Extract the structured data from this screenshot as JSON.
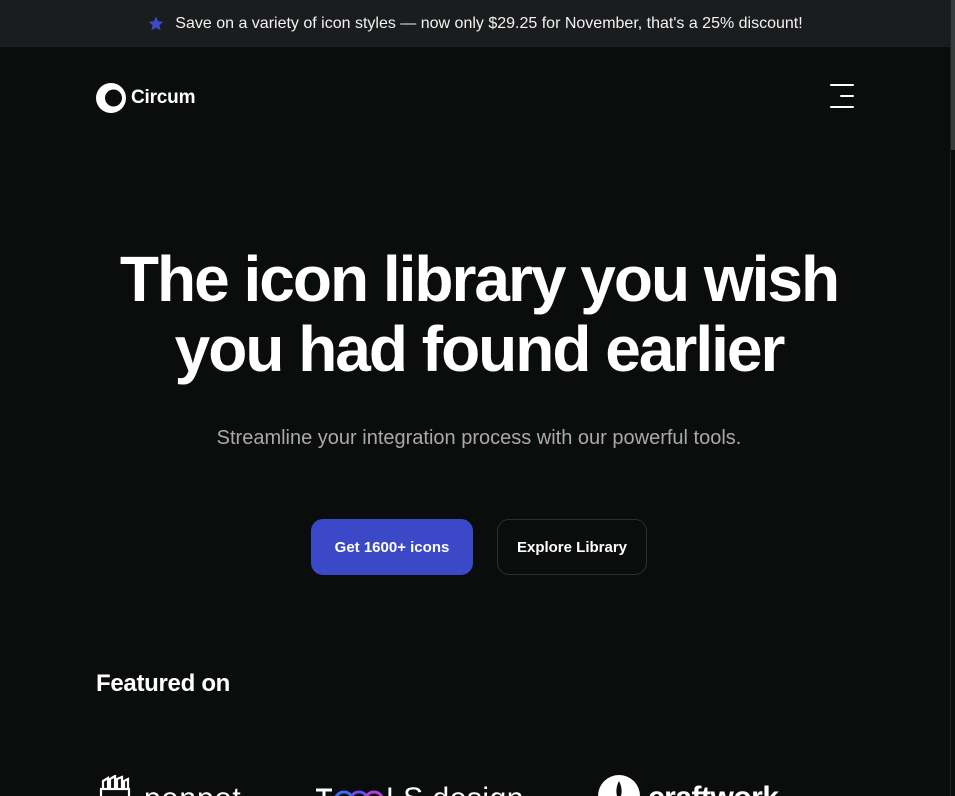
{
  "promo": {
    "text": "Save on a variety of icon styles — now only $29.25 for November, that's a 25% discount!",
    "icon": "star-icon",
    "icon_color": "#3b49c8"
  },
  "header": {
    "logo_text": "Circum",
    "menu_icon": "hamburger-menu-icon"
  },
  "hero": {
    "title_line1": "The icon library you wish",
    "title_line2": "you had found earlier",
    "subtitle": "Streamline your integration process with our powerful tools.",
    "primary_button": "Get 1600+ icons",
    "secondary_button": "Explore Library",
    "accent_color": "#3b49c8"
  },
  "featured": {
    "title": "Featured on",
    "brands": [
      {
        "name": "penpot",
        "icon": "penpot-logo-icon"
      },
      {
        "name": "TOOOLS.design",
        "icon": "toools-logo-icon"
      },
      {
        "name": "craftwork",
        "icon": "craftwork-logo-icon"
      }
    ]
  },
  "colors": {
    "background": "#0b0c0c",
    "promo_background": "#1b1c1e",
    "subtitle_text": "#a9a9ab"
  }
}
